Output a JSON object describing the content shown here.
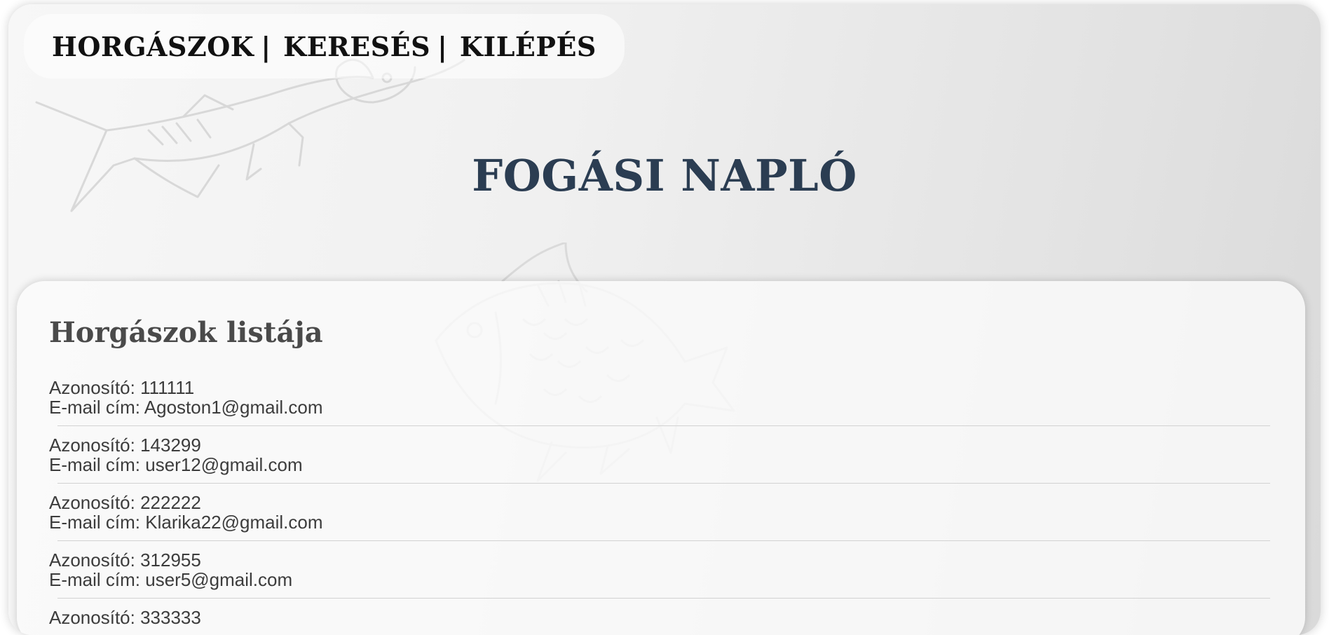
{
  "nav": {
    "items": [
      {
        "label": "HORGÁSZOK"
      },
      {
        "label": "KERESÉS"
      },
      {
        "label": "KILÉPÉS"
      }
    ],
    "separator": "|"
  },
  "app_title": "FOGÁSI NAPLÓ",
  "card": {
    "title": "Horgászok listája",
    "id_label": "Azonosító:",
    "email_label": "E-mail cím:",
    "anglers": [
      {
        "id": "111111",
        "email": "Agoston1@gmail.com"
      },
      {
        "id": "143299",
        "email": "user12@gmail.com"
      },
      {
        "id": "222222",
        "email": "Klarika22@gmail.com"
      },
      {
        "id": "312955",
        "email": "user5@gmail.com"
      },
      {
        "id": "333333",
        "email": ""
      }
    ]
  },
  "colors": {
    "title": "#2b3d52",
    "nav_text": "#111111",
    "card_title": "#4a4a4a",
    "body_text": "#3c3c3c"
  },
  "icons": [
    "pike-fish-watermark-icon",
    "carp-fish-watermark-icon"
  ]
}
